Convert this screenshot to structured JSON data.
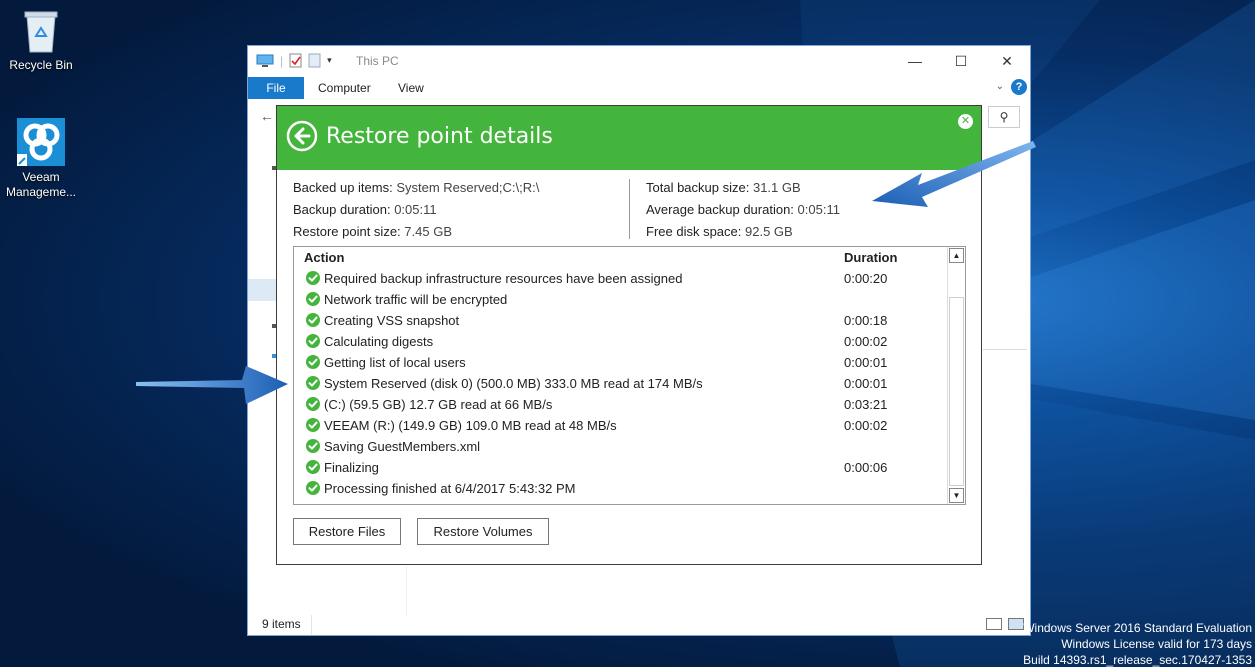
{
  "desktop": {
    "icons": [
      {
        "label": "Recycle Bin",
        "icon": "recycle-bin-icon"
      },
      {
        "label": "Veeam Manageme...",
        "icon": "veeam-icon"
      }
    ],
    "watermark": [
      "Windows Server 2016 Standard Evaluation",
      "Windows License valid for 173 days",
      "Build 14393.rs1_release_sec.170427-1353"
    ]
  },
  "explorer": {
    "title": "This PC",
    "tabs": {
      "file": "File",
      "computer": "Computer",
      "view": "View"
    },
    "status": "9 items"
  },
  "dialog": {
    "title": "Restore point details",
    "accent_color": "#44b53c",
    "left": [
      {
        "key": "Backed up items:",
        "value": "System Reserved;C:\\;R:\\"
      },
      {
        "key": "Backup duration:",
        "value": "0:05:11"
      },
      {
        "key": "Restore point size:",
        "value": "7.45 GB"
      }
    ],
    "right": [
      {
        "key": "Total backup size:",
        "value": "31.1 GB"
      },
      {
        "key": "Average backup duration:",
        "value": "0:05:11"
      },
      {
        "key": "Free disk space:",
        "value": "92.5 GB"
      }
    ],
    "columns": {
      "action": "Action",
      "duration": "Duration"
    },
    "rows": [
      {
        "action": "Required backup infrastructure resources have been assigned",
        "duration": "0:00:20"
      },
      {
        "action": "Network traffic will be encrypted",
        "duration": ""
      },
      {
        "action": "Creating VSS snapshot",
        "duration": "0:00:18"
      },
      {
        "action": "Calculating digests",
        "duration": "0:00:02"
      },
      {
        "action": "Getting list of local users",
        "duration": "0:00:01"
      },
      {
        "action": "System Reserved (disk 0) (500.0 MB) 333.0 MB read at 174 MB/s",
        "duration": "0:00:01"
      },
      {
        "action": " (C:) (59.5 GB) 12.7 GB read at 66 MB/s",
        "duration": "0:03:21"
      },
      {
        "action": "VEEAM (R:) (149.9 GB) 109.0 MB read at 48 MB/s",
        "duration": "0:00:02"
      },
      {
        "action": "Saving GuestMembers.xml",
        "duration": ""
      },
      {
        "action": "Finalizing",
        "duration": "0:00:06"
      },
      {
        "action": "Processing finished at 6/4/2017 5:43:32 PM",
        "duration": ""
      }
    ],
    "buttons": {
      "restore_files": "Restore Files",
      "restore_volumes": "Restore Volumes"
    }
  }
}
